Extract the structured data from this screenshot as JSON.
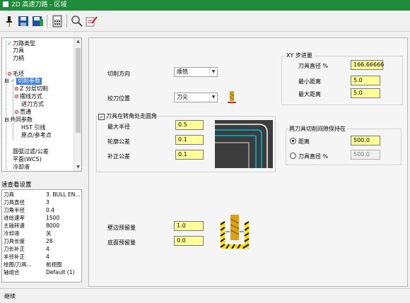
{
  "window": {
    "title": "2D 高速刀路 - 区域"
  },
  "toolbar": {
    "icons": [
      "pin-icon",
      "save-icon",
      "save-all-icon",
      "calculator-icon",
      "preview-icon",
      "edit-icon"
    ]
  },
  "tree": {
    "items": [
      {
        "label": "刀路类型",
        "mark": "check"
      },
      {
        "label": "刀具",
        "mark": ""
      },
      {
        "label": "刀柄",
        "mark": ""
      },
      {
        "label": "毛坯",
        "mark": "ban"
      },
      {
        "label": "切削参数",
        "mark": "check"
      },
      {
        "label": "Z 分层切削",
        "mark": "ban"
      },
      {
        "label": "摆线方式",
        "mark": "ban"
      },
      {
        "label": "进刀方式",
        "mark": ""
      },
      {
        "label": "贯通",
        "mark": "ban"
      },
      {
        "label": "共同参数",
        "mark": ""
      },
      {
        "label": "HST 引线",
        "mark": ""
      },
      {
        "label": "原点/参考点",
        "mark": ""
      },
      {
        "label": "圆弧过滤/公差",
        "mark": ""
      },
      {
        "label": "平面(WCS)",
        "mark": ""
      },
      {
        "label": "冷却液",
        "mark": ""
      }
    ]
  },
  "quick_view": {
    "title": "速查看设置",
    "rows": [
      {
        "key": "刀具",
        "value": "3. BULL EN..."
      },
      {
        "key": "刀具直径",
        "value": "3"
      },
      {
        "key": "刀角半径",
        "value": "0.4"
      },
      {
        "key": "进给速率",
        "value": "1500"
      },
      {
        "key": "主轴转速",
        "value": "8000"
      },
      {
        "key": "冷却液",
        "value": "关"
      },
      {
        "key": "刀具长度",
        "value": "28"
      },
      {
        "key": "刀长补正",
        "value": "4"
      },
      {
        "key": "半径补正",
        "value": "4"
      },
      {
        "key": "绘图/刀具...",
        "value": "前视图"
      },
      {
        "key": "轴组合",
        "value": "Default (1)"
      }
    ]
  },
  "main": {
    "cut_direction": {
      "label": "切削方向",
      "value": "顺铣"
    },
    "tip_position": {
      "label": "校刀位置",
      "value": "刀尖"
    },
    "corner_round": {
      "checkbox_label": "刀具在转角处走圆角",
      "max_radius_label": "最大半径",
      "max_radius": "0.5",
      "contour_tol_label": "轮廓公差",
      "contour_tol": "0.1",
      "offset_tol_label": "补正公差",
      "offset_tol": "0.1"
    },
    "xy_step": {
      "title": "XY 步进量",
      "diameter_pct_label": "刀具直径 %",
      "diameter_pct": "166.66666",
      "min_dist_label": "最小距离",
      "min_dist": "5.0",
      "max_dist_label": "最大距离",
      "max_dist": "5.0"
    },
    "gap": {
      "title": "两刀具切削间隙保持在",
      "distance_label": "距离",
      "distance": "500.0",
      "diameter_pct_label": "刀具直径 %",
      "diameter_pct": "500.0"
    },
    "stock": {
      "wall_label": "壁边预留量",
      "wall": "1.0",
      "floor_label": "底面预留量",
      "floor": "0.0"
    }
  },
  "bottom": {
    "label": "继续"
  },
  "colors": {
    "titlebar": "#1e8c3a",
    "field": "#ffff99",
    "selected": "#3a7bd5"
  }
}
